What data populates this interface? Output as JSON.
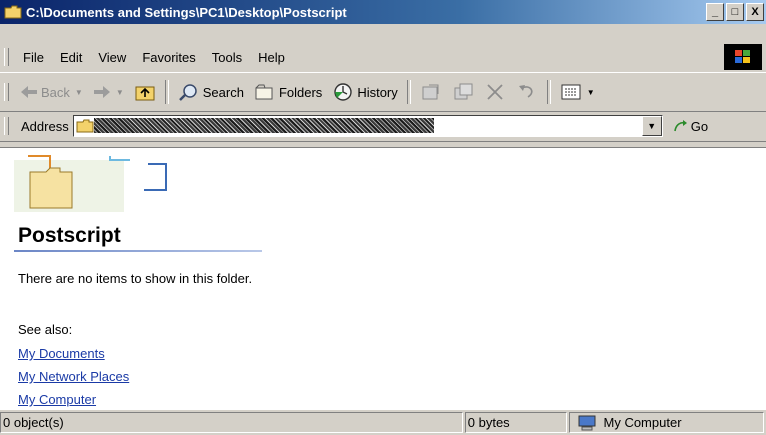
{
  "window": {
    "title": "C:\\Documents and Settings\\PC1\\Desktop\\Postscript",
    "minimize": "_",
    "maximize": "□",
    "close": "X"
  },
  "menu": {
    "items": [
      {
        "label": "File"
      },
      {
        "label": "Edit"
      },
      {
        "label": "View"
      },
      {
        "label": "Favorites"
      },
      {
        "label": "Tools"
      },
      {
        "label": "Help"
      }
    ]
  },
  "toolbar": {
    "back": "Back",
    "search": "Search",
    "folders": "Folders",
    "history": "History"
  },
  "address": {
    "label": "Address",
    "go": "Go"
  },
  "content": {
    "folder_name": "Postscript",
    "empty_message": "There are no items to show in this folder.",
    "see_also": "See also:",
    "links": [
      "My Documents",
      "My Network Places",
      "My Computer"
    ]
  },
  "status": {
    "objects": "0 object(s)",
    "size": "0 bytes",
    "zone": "My Computer"
  },
  "colors": {
    "title_start": "#0a246a",
    "title_end": "#a6caf0",
    "chrome": "#d4d0c8",
    "link": "#1a3aa6"
  }
}
